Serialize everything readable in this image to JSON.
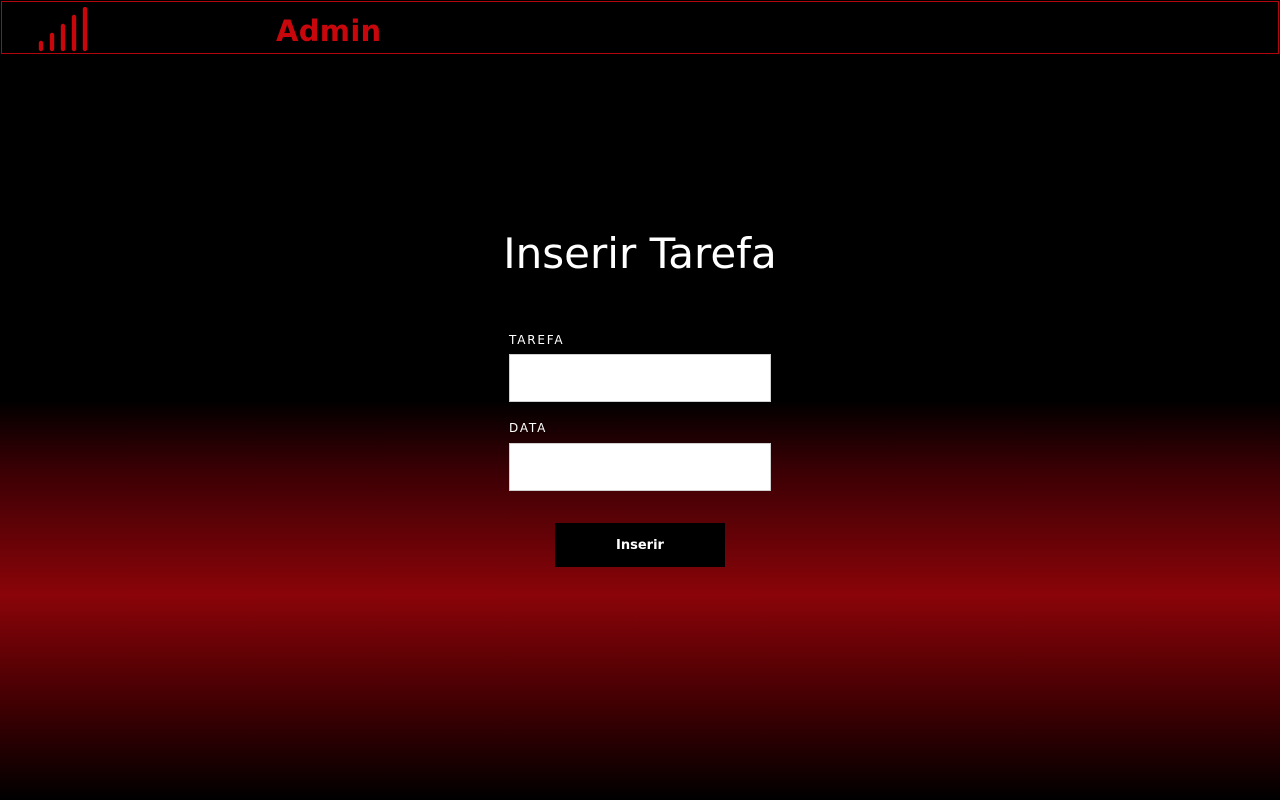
{
  "header": {
    "brand": "Admin",
    "brand_color": "#c8070c",
    "logo_icon": "signal-bars-icon"
  },
  "page": {
    "title": "Inserir Tarefa"
  },
  "form": {
    "tarefa_label": "TAREFA",
    "tarefa_value": "",
    "data_label": "DATA",
    "data_value": "",
    "submit_label": "Inserir"
  },
  "colors": {
    "accent_red": "#c8070c",
    "gradient_red": "#8a0409",
    "background": "#000000",
    "button_bg": "#000000",
    "input_bg": "#ffffff"
  }
}
